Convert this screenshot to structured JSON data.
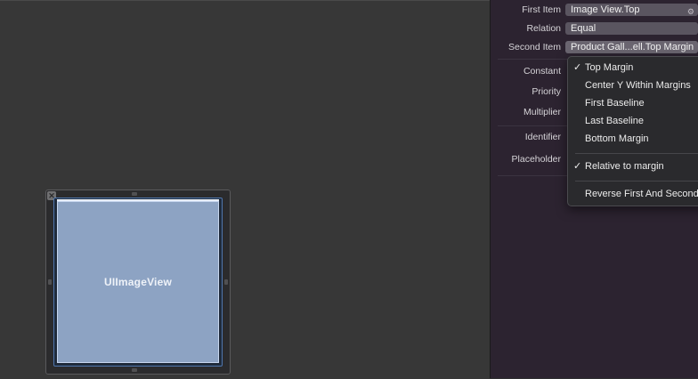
{
  "canvas": {
    "image_view_label": "UIImageView",
    "close_glyph": "✕"
  },
  "inspector": {
    "first_item": {
      "label": "First Item",
      "value": "Image View.Top"
    },
    "relation": {
      "label": "Relation",
      "value": "Equal"
    },
    "second_item": {
      "label": "Second Item",
      "value": "Product Gall...ell.Top Margin"
    },
    "constant": {
      "label": "Constant"
    },
    "priority": {
      "label": "Priority"
    },
    "multiplier": {
      "label": "Multiplier"
    },
    "identifier": {
      "label": "Identifier"
    },
    "placeholder": {
      "label": "Placeholder"
    }
  },
  "menu": {
    "items": [
      {
        "label": "Top Margin",
        "checked": "✓"
      },
      {
        "label": "Center Y Within Margins",
        "checked": ""
      },
      {
        "label": "First Baseline",
        "checked": ""
      },
      {
        "label": "Last Baseline",
        "checked": ""
      },
      {
        "label": "Bottom Margin",
        "checked": ""
      }
    ],
    "relative_to_margin": {
      "label": "Relative to margin",
      "checked": "✓"
    },
    "reverse": {
      "label": "Reverse First And Second Item"
    }
  },
  "colors": {
    "canvas_bg": "#373737",
    "inspector_bg": "#2c2330",
    "image_view_fill": "#8da3c3",
    "selection_border": "#4f76ad"
  },
  "icons": {
    "first_item_icon": "gear-icon",
    "close": "close-icon"
  }
}
